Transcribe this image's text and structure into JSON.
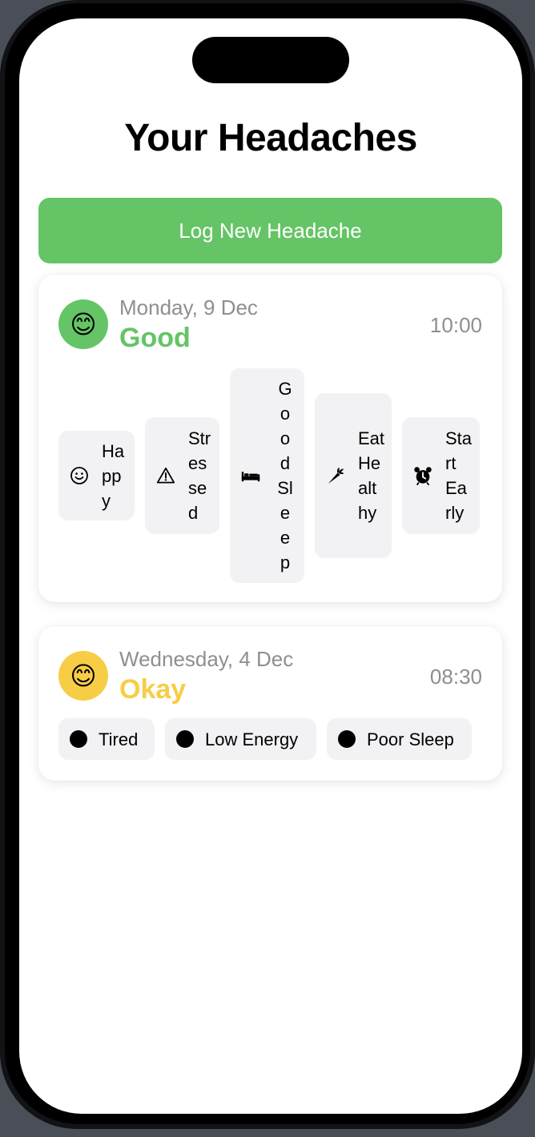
{
  "page": {
    "title": "Your Headaches"
  },
  "actions": {
    "log_button_label": "Log New Headache"
  },
  "colors": {
    "good": "#65c466",
    "okay": "#f7cd46",
    "secondary_text": "#8e8e93",
    "tag_background": "#f2f2f4"
  },
  "entries": [
    {
      "date": "Monday, 9 Dec",
      "mood": "Good",
      "mood_emoji": "😊",
      "time": "10:00",
      "tags": [
        {
          "label": "Happy",
          "icon": "smiley-face-icon"
        },
        {
          "label": "Stressed",
          "icon": "warning-triangle-icon"
        },
        {
          "label": "Good Sleep",
          "icon": "bed-icon"
        },
        {
          "label": "Eat Healthy",
          "icon": "carrot-icon"
        },
        {
          "label": "Start Early",
          "icon": "alarm-clock-icon"
        }
      ]
    },
    {
      "date": "Wednesday, 4 Dec",
      "mood": "Okay",
      "mood_emoji": "😊",
      "time": "08:30",
      "tags": [
        {
          "label": "Tired",
          "icon": "dot-icon"
        },
        {
          "label": "Low Energy",
          "icon": "dot-icon"
        },
        {
          "label": "Poor Sleep",
          "icon": "dot-icon"
        }
      ]
    }
  ]
}
